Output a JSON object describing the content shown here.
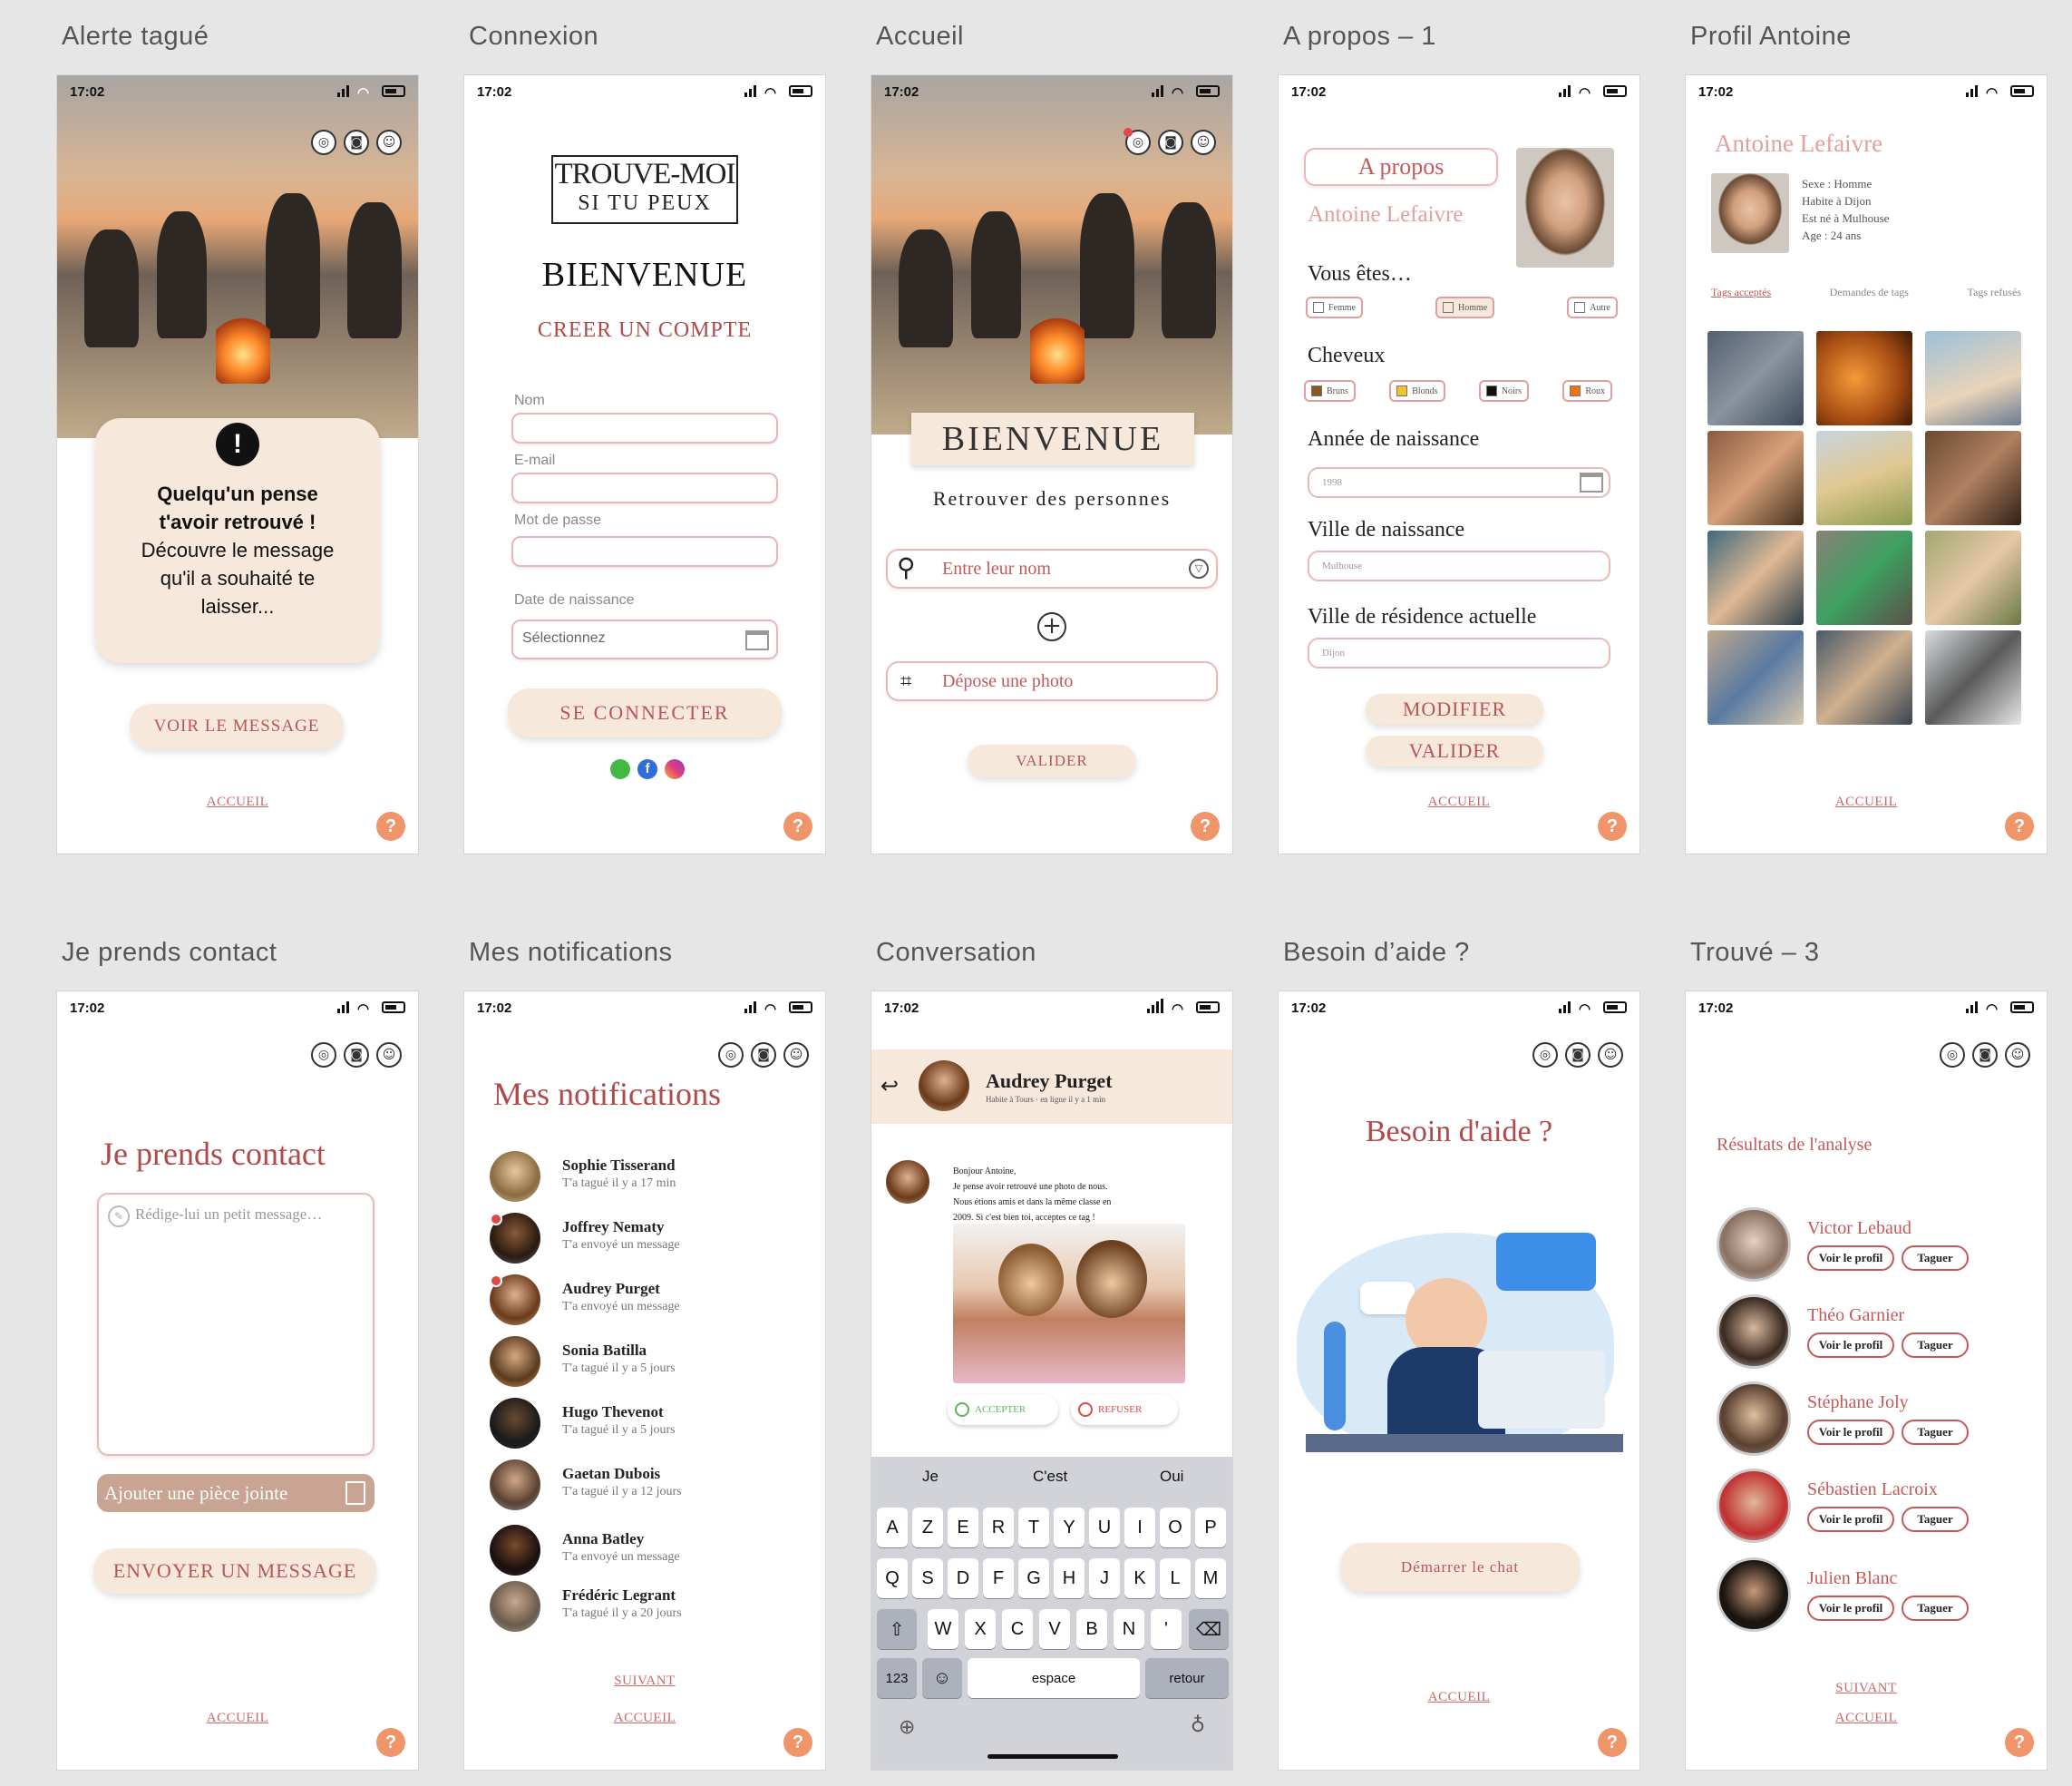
{
  "frames": {
    "f1": "Alerte tagué",
    "f2": "Connexion",
    "f3": "Accueil",
    "f4": "A propos – 1",
    "f5": "Profil Antoine",
    "f6": "Je prends contact",
    "f7": "Mes notifications",
    "f8": "Conversation",
    "f9": "Besoin d’aide ?",
    "f10": "Trouvé – 3"
  },
  "status_time": "17:02",
  "common": {
    "accueil": "ACCUEIL",
    "help": "?"
  },
  "alerte": {
    "line1": "Quelqu'un pense",
    "line2": "t'avoir retrouvé !",
    "line3": "Découvre le message",
    "line4": "qu'il a souhaité te",
    "line5": "laisser...",
    "button": "VOIR LE MESSAGE"
  },
  "connexion": {
    "logo_top": "TROUVE-MOI",
    "logo_bottom": "SI TU PEUX",
    "welcome": "BIENVENUE",
    "create": "CREER UN COMPTE",
    "nom": "Nom",
    "email": "E-mail",
    "password": "Mot de passe",
    "birth": "Date de naissance",
    "select": "Sélectionnez",
    "connect": "SE CONNECTER"
  },
  "accueil": {
    "banner": "BIENVENUE",
    "subtitle": "Retrouver des personnes",
    "search_placeholder": "Entre leur nom",
    "photo": "Dépose une photo",
    "validate": "VALIDER"
  },
  "apropos": {
    "title": "A propos",
    "name": "Antoine Lefaivre",
    "vous": "Vous êtes…",
    "femme": "Femme",
    "homme": "Homme",
    "autre": "Autre",
    "cheveux": "Cheveux",
    "bruns": "Bruns",
    "blonds": "Blonds",
    "noirs": "Noirs",
    "roux": "Roux",
    "annee": "Année de naissance",
    "annee_val": "1998",
    "ville": "Ville de naissance",
    "ville_val": "Mulhouse",
    "residence": "Ville de résidence actuelle",
    "residence_val": "Dijon",
    "modifier": "MODIFIER",
    "valider": "VALIDER"
  },
  "profil": {
    "name": "Antoine Lefaivre",
    "l1": "Sexe : Homme",
    "l2": "Habite à Dijon",
    "l3": "Est né à Mulhouse",
    "l4": "Age : 24 ans",
    "tab1": "Tags acceptés",
    "tab2": "Demandes de tags",
    "tab3": "Tags refusés"
  },
  "contact": {
    "title": "Je prends contact",
    "placeholder": "Rédige-lui un petit message…",
    "attach": "Ajouter une pièce jointe",
    "send": "ENVOYER UN MESSAGE"
  },
  "notifs": {
    "title": "Mes notifications",
    "items": [
      {
        "name": "Sophie Tisserand",
        "sub": "T'a tagué il y a 17 min"
      },
      {
        "name": "Joffrey Nematy",
        "sub": "T'a envoyé un message"
      },
      {
        "name": "Audrey Purget",
        "sub": "T'a envoyé un message"
      },
      {
        "name": "Sonia Batilla",
        "sub": "T'a tagué il y a 5 jours"
      },
      {
        "name": "Hugo Thevenot",
        "sub": "T'a tagué il y a 5 jours"
      },
      {
        "name": "Gaetan Dubois",
        "sub": "T'a tagué il y a 12 jours"
      },
      {
        "name": "Anna Batley",
        "sub": "T'a envoyé un message"
      },
      {
        "name": "Frédéric Legrant",
        "sub": "T'a tagué il y a 20 jours"
      }
    ],
    "next": "SUIVANT"
  },
  "conv": {
    "name": "Audrey Purget",
    "sub": "Habite à Tours · en ligne il y a 1 min",
    "m1": "Bonjour Antoine,",
    "m2": "Je pense avoir retrouvé une photo de nous.",
    "m3": "Nous étions amis et dans la même classe en",
    "m4": "2009. Si c'est bien toi, acceptes ce tag !",
    "accept": "ACCEPTER",
    "refuse": "REFUSER",
    "s1": "Je",
    "s2": "C'est",
    "s3": "Oui",
    "row1": [
      "A",
      "Z",
      "E",
      "R",
      "T",
      "Y",
      "U",
      "I",
      "O",
      "P"
    ],
    "row2": [
      "Q",
      "S",
      "D",
      "F",
      "G",
      "H",
      "J",
      "K",
      "L",
      "M"
    ],
    "row3": [
      "W",
      "X",
      "C",
      "V",
      "B",
      "N",
      "'"
    ],
    "k123": "123",
    "space": "espace",
    "ret": "retour"
  },
  "aide": {
    "title": "Besoin d'aide ?",
    "chat": "Démarrer le chat"
  },
  "trouve": {
    "title": "Résultats de l'analyse",
    "view": "Voir le profil",
    "tag": "Taguer",
    "people": [
      "Victor Lebaud",
      "Théo Garnier",
      "Stéphane Joly",
      "Sébastien Lacroix",
      "Julien Blanc"
    ],
    "next": "SUIVANT"
  },
  "colors": {
    "accent": "#b04a4a",
    "pill": "#f7e8dc",
    "help": "#f0956a",
    "border": "#eab8b8"
  }
}
